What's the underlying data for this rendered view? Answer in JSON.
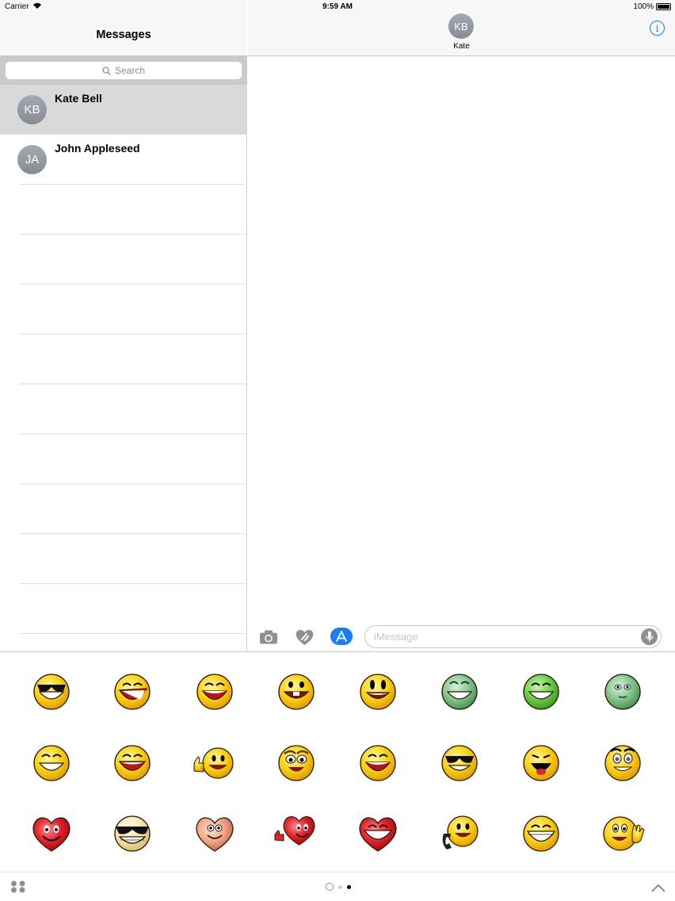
{
  "status_bar": {
    "carrier": "Carrier",
    "time": "9:59 AM",
    "battery": "100%"
  },
  "sidebar": {
    "title": "Messages",
    "search_placeholder": "Search",
    "conversations": [
      {
        "initials": "KB",
        "name": "Kate Bell",
        "selected": true
      },
      {
        "initials": "JA",
        "name": "John Appleseed",
        "selected": false
      }
    ]
  },
  "conversation": {
    "contact_initials": "KB",
    "contact_name": "Kate",
    "composer_placeholder": "iMessage"
  },
  "icons": {
    "status": [
      "wifi-icon",
      "battery-icon"
    ],
    "header": [
      "info-icon"
    ],
    "composer": [
      "camera-icon",
      "digital-touch-heart-icon",
      "app-store-icon",
      "microphone-icon"
    ],
    "drawer": [
      "app-grid-icon",
      "recents-icon",
      "chevron-up-icon"
    ]
  },
  "stickers": [
    "sunglasses-smiley",
    "tilted-laughing-smiley",
    "big-grin-smiley",
    "buck-teeth-smiley",
    "grinning-smiley",
    "green-grinning-smiley",
    "green-laughing-smiley",
    "green-smiley",
    "squinting-grin-smiley",
    "laughing-tongue-smiley",
    "thumbs-up-smiley",
    "nerd-smiley",
    "laughing-smiley",
    "cool-grin-smiley",
    "open-mouth-laughing-smiley",
    "wide-eyed-smiley",
    "red-heart-smiley",
    "sunglasses-grin-smiley",
    "pink-heart-smiley",
    "thumbs-up-heart-smiley",
    "laughing-heart-smiley",
    "phone-call-smiley",
    "wide-grin-smiley",
    "waving-smiley"
  ],
  "drawer_pages": {
    "count": 2,
    "current": 2
  },
  "colors": {
    "accent": "#1a7cf6",
    "avatar": "#9499a3",
    "selected_row": "#d9d9d9"
  }
}
